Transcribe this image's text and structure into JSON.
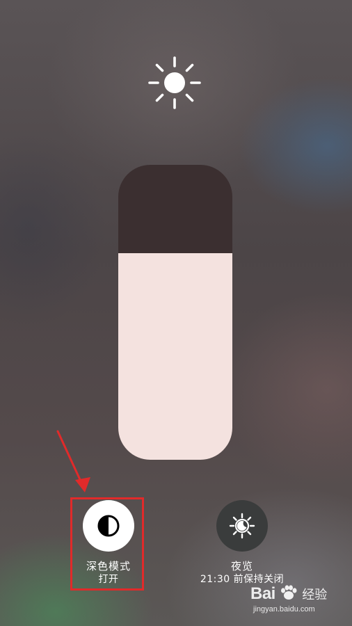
{
  "brightness": {
    "level": 0.7
  },
  "controls": {
    "dark_mode": {
      "label": "深色模式",
      "status": "打开",
      "active": true
    },
    "night_shift": {
      "label": "夜览",
      "status": "21:30 前保持关闭",
      "active": false
    }
  },
  "watermark": {
    "brand": "Bai",
    "brand_suffix": "经验",
    "site": "jingyan.baidu.com"
  },
  "colors": {
    "annotation": "#e12a2a",
    "slider_fill": "#f4e2df",
    "slider_track": "#3b2f30"
  }
}
